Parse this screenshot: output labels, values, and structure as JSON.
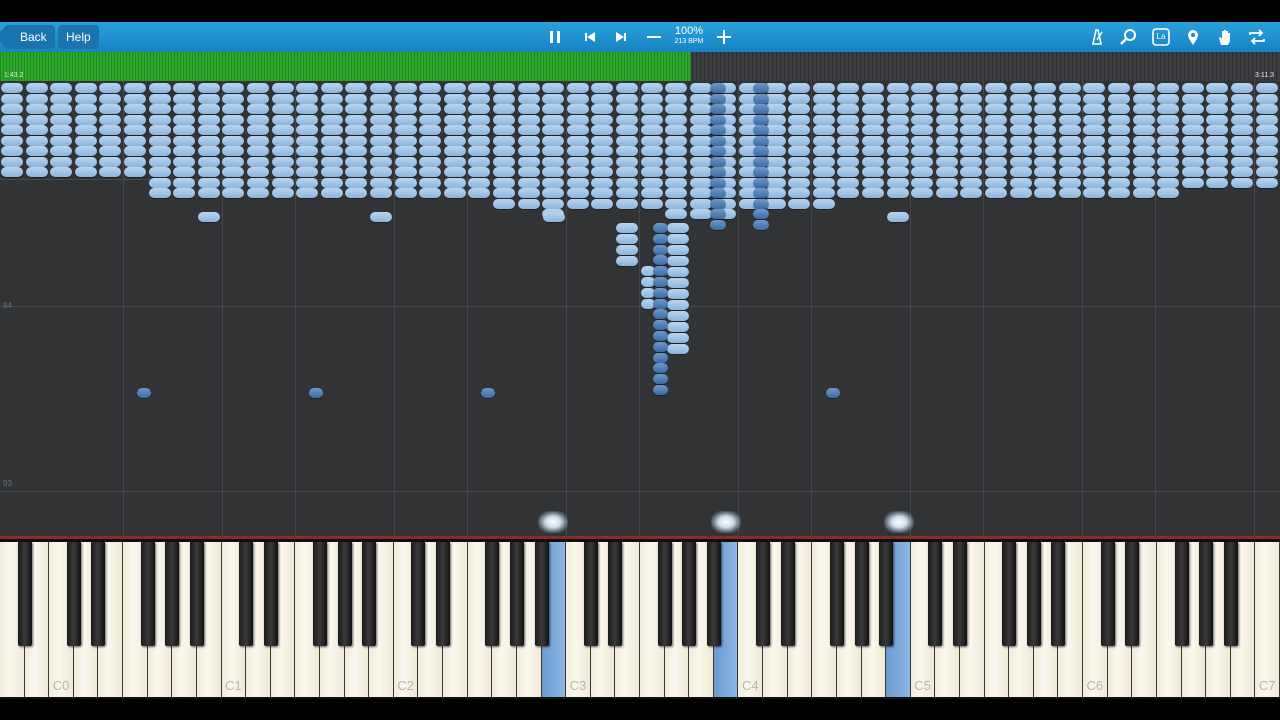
{
  "toolbar": {
    "back_label": "Back",
    "help_label": "Help",
    "speed_percent": "100%",
    "bpm": "213 BPM",
    "icons": [
      "pause-icon",
      "previous-icon",
      "next-icon",
      "minus-icon",
      "plus-icon",
      "metronome-icon",
      "search-icon",
      "la-icon",
      "location-pin-icon",
      "hand-icon",
      "loop-icon"
    ],
    "la_text": "La"
  },
  "progress": {
    "elapsed": "1:43.2",
    "total": "3:11.3",
    "fraction": 0.54,
    "color": "#29a82a"
  },
  "measures": [
    "94",
    "93"
  ],
  "keyboard": {
    "octave_labels": [
      "C0",
      "C1",
      "C2",
      "C3",
      "C4",
      "C5",
      "C6",
      "C7"
    ],
    "pressed_keys": [
      "C3 (black key left)",
      "C4 (black key left)",
      "C5 (black key left)"
    ],
    "pressed_color": "#6b9bd0"
  },
  "colors": {
    "note_light": "#b9d5f0",
    "note_dark": "#3c6ba4",
    "background": "#313335",
    "toolbar": "#1e8fd0"
  }
}
